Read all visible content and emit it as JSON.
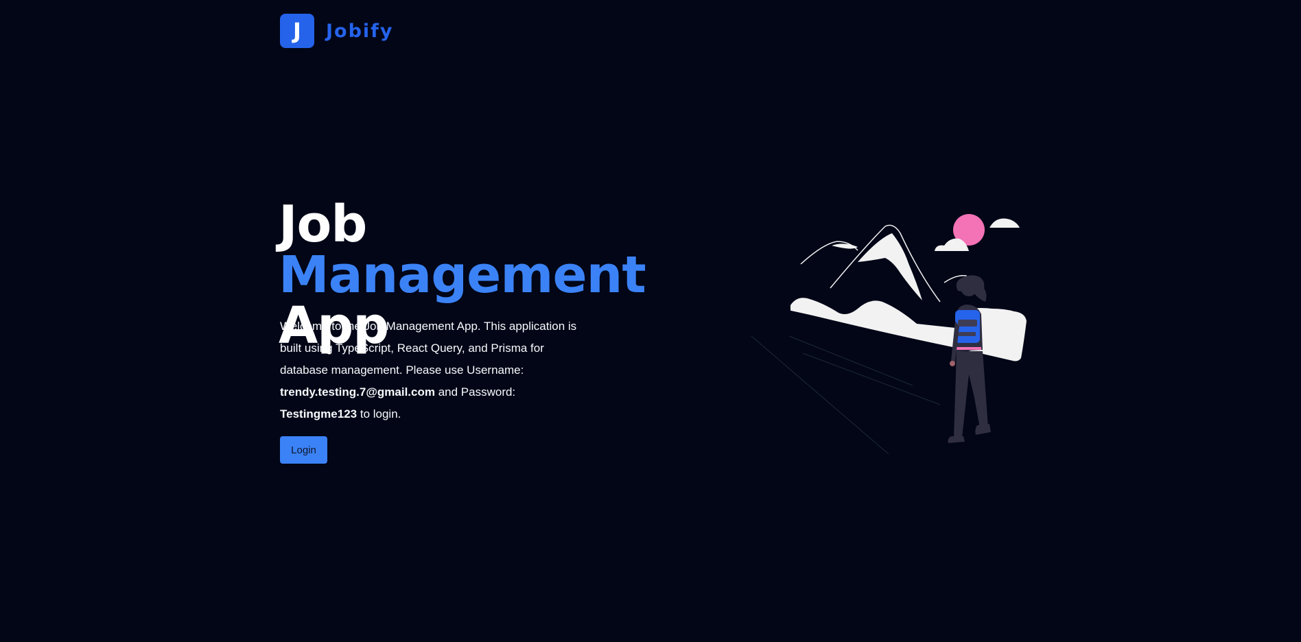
{
  "navbar": {
    "logo_letter": "J",
    "brand_name": "Jobify"
  },
  "hero": {
    "title_part1": "Job ",
    "title_accent": "Management",
    "title_part2": "App",
    "description_intro": "Welcome to the Job Management App. This application is built using TypeScript, React Query, and Prisma for database management. Please use Username: ",
    "username": "trendy.testing.7@gmail.com",
    "password_label": " and Password: ",
    "password": "Testingme123",
    "description_outro": " to login.",
    "login_label": "Login"
  },
  "illustration": {
    "icon": "hiker-mountains-illustration",
    "colors": {
      "sun": "#f472b6",
      "mountains": "#f2f2f2",
      "backpack": "#2563eb",
      "figure": "#2f2e41"
    }
  },
  "colors": {
    "background": "#020617",
    "accent": "#3b82f6",
    "brand": "#2563eb",
    "text": "#f8fafc"
  }
}
